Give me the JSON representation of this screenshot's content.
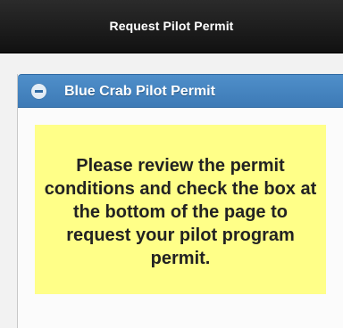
{
  "header": {
    "title": "Request Pilot Permit"
  },
  "section": {
    "title": "Blue Crab Pilot Permit",
    "toggle_icon": "minus-circle-icon",
    "expanded": true
  },
  "notice": {
    "text": "Please review the permit conditions and check the box at the bottom of the page to request your pilot program permit."
  },
  "colors": {
    "header_background": "#1a1a1a",
    "section_header_blue": "#4585c1",
    "notice_background": "#ffff88"
  }
}
